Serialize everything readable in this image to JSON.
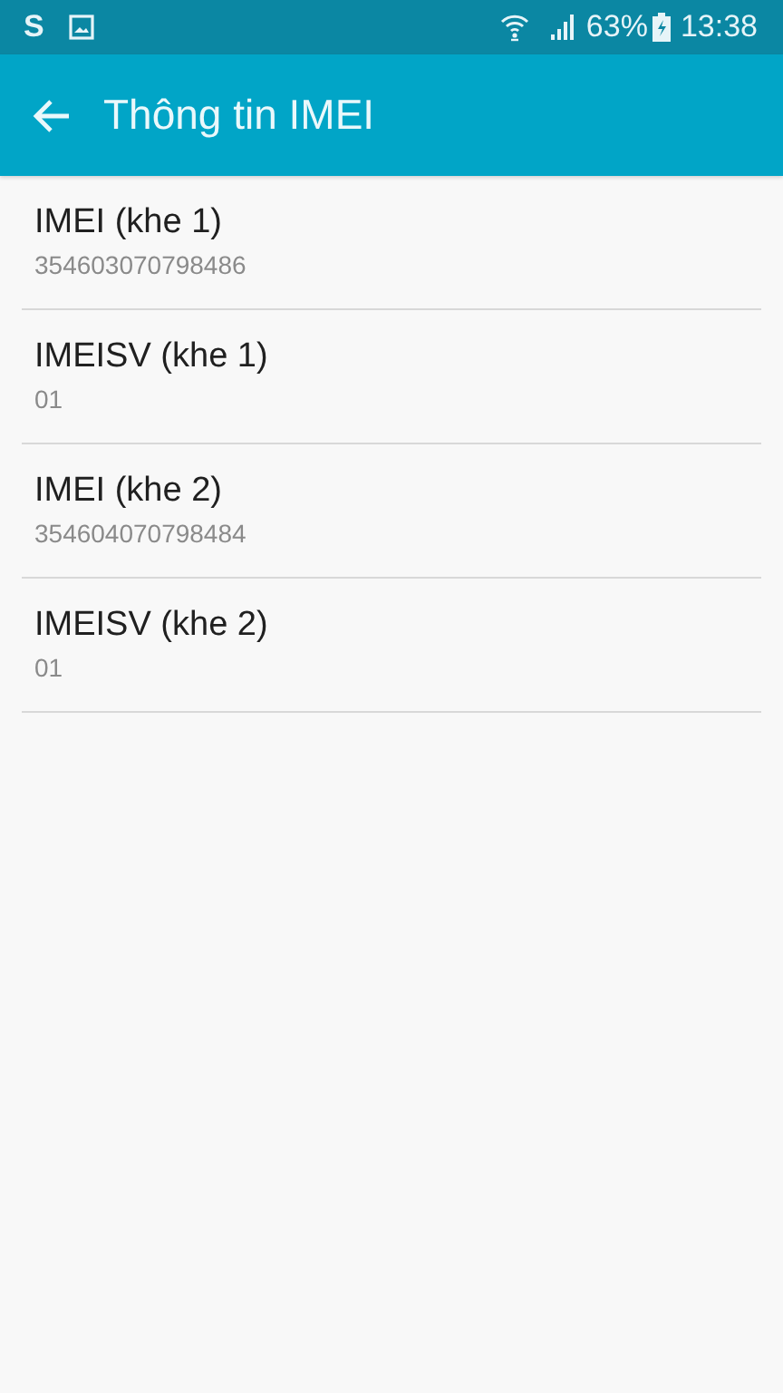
{
  "status_bar": {
    "app_glyph": "S",
    "battery": "63%",
    "time": "13:38"
  },
  "app_bar": {
    "title": "Thông tin IMEI"
  },
  "items": [
    {
      "title": "IMEI (khe 1)",
      "value": "354603070798486"
    },
    {
      "title": "IMEISV (khe 1)",
      "value": "01"
    },
    {
      "title": "IMEI (khe 2)",
      "value": "354604070798484"
    },
    {
      "title": "IMEISV (khe 2)",
      "value": "01"
    }
  ]
}
